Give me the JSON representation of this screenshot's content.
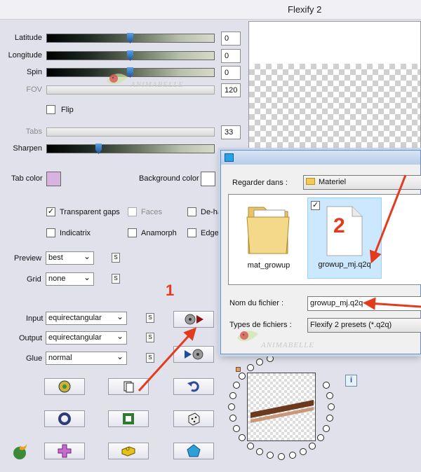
{
  "window": {
    "title": "Flexify 2"
  },
  "sliders": [
    {
      "label": "Latitude",
      "value": "0",
      "level": 0.5,
      "enabled": true
    },
    {
      "label": "Longitude",
      "value": "0",
      "level": 0.5,
      "enabled": true
    },
    {
      "label": "Spin",
      "value": "0",
      "level": 0.5,
      "enabled": true
    },
    {
      "label": "FOV",
      "value": "120",
      "enabled": false
    },
    {
      "label": "Tabs",
      "value": "33",
      "enabled": false
    },
    {
      "label": "Sharpen",
      "value": "30",
      "level": 0.3,
      "enabled": true
    }
  ],
  "flip": {
    "label": "Flip",
    "checked": false
  },
  "colors": {
    "tab_color_label": "Tab color",
    "tab_color": "#d9b3e0",
    "bg_color_label": "Background color",
    "bg_color": "#ffffff"
  },
  "options": {
    "transparent_gaps": {
      "label": "Transparent gaps",
      "checked": true
    },
    "faces": {
      "label": "Faces",
      "checked": false
    },
    "de_ha": {
      "label": "De-ha",
      "checked": false
    },
    "indicatrix": {
      "label": "Indicatrix",
      "checked": false
    },
    "anamorph": {
      "label": "Anamorph",
      "checked": false
    },
    "edges": {
      "label": "Edges",
      "checked": false
    }
  },
  "selects": {
    "preview": {
      "label": "Preview",
      "value": "best"
    },
    "grid": {
      "label": "Grid",
      "value": "none"
    },
    "input": {
      "label": "Input",
      "value": "equirectangular"
    },
    "output": {
      "label": "Output",
      "value": "equirectangular"
    },
    "glue": {
      "label": "Glue",
      "value": "normal"
    }
  },
  "s_label": "S",
  "dialog": {
    "look_in_label": "Regarder dans :",
    "look_in_value": "Materiel",
    "files": [
      {
        "name": "mat_growup",
        "type": "folder"
      },
      {
        "name": "growup_mj.q2q",
        "type": "file",
        "selected": true
      }
    ],
    "filename_label": "Nom du fichier :",
    "filename_value": "growup_mj.q2q",
    "filetype_label": "Types de fichiers :",
    "filetype_value": "Flexify 2 presets (*.q2q)"
  },
  "annotations": {
    "one": "1",
    "two": "2"
  },
  "watermark": "ANIMABELLE",
  "info_label": "i",
  "accent_red": "#e23b1e"
}
